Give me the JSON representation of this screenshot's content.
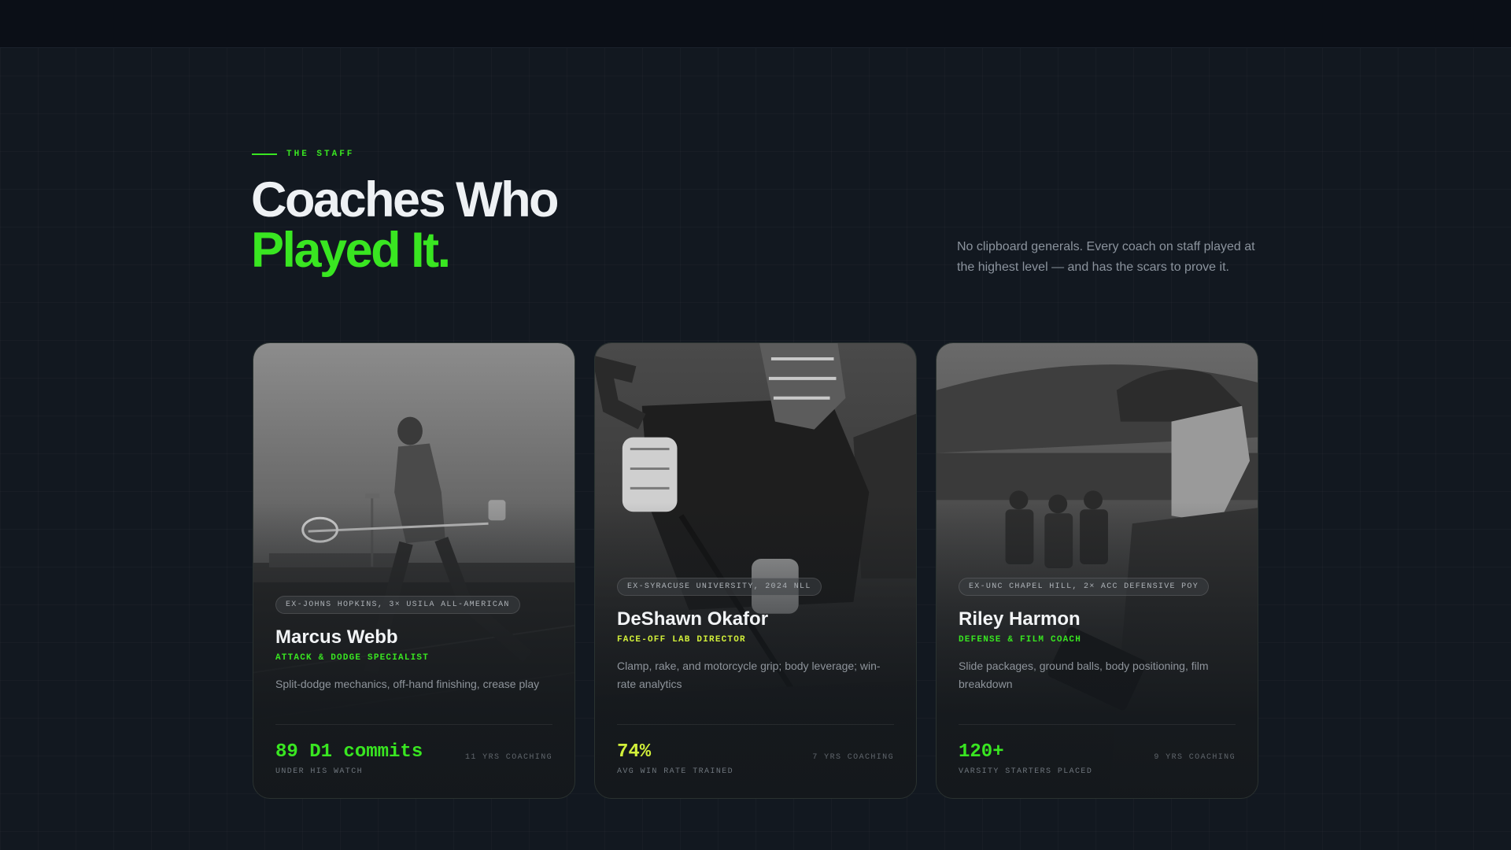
{
  "section": {
    "eyebrow": "THE STAFF",
    "title_line1": "Coaches Who",
    "title_line2": "Played It.",
    "intro": "No clipboard generals. Every coach on staff played at the highest level — and has the scars to prove it."
  },
  "colors": {
    "accent_green": "#39e621",
    "accent_lime": "#d2f03a",
    "background": "#121820"
  },
  "coaches": [
    {
      "badge": "EX-JOHNS HOPKINS, 3× USILA ALL-AMERICAN",
      "name": "Marcus Webb",
      "role": "ATTACK & DODGE SPECIALIST",
      "description": "Split-dodge mechanics, off-hand finishing, crease play",
      "stat_value": "89 D1 commits",
      "stat_label": "UNDER HIS WATCH",
      "years": "11 YRS COACHING",
      "accent": "#39e621",
      "photo": "lacrosse-player-running-photo"
    },
    {
      "badge": "EX-SYRACUSE UNIVERSITY, 2024 NLL",
      "name": "DeShawn Okafor",
      "role": "FACE-OFF LAB DIRECTOR",
      "description": "Clamp, rake, and motorcycle grip; body leverage; win-rate analytics",
      "stat_value": "74%",
      "stat_label": "AVG WIN RATE TRAINED",
      "years": "7 YRS COACHING",
      "accent": "#d2f03a",
      "photo": "faceoff-stance-photo"
    },
    {
      "badge": "EX-UNC CHAPEL HILL, 2× ACC DEFENSIVE POY",
      "name": "Riley Harmon",
      "role": "DEFENSE & FILM COACH",
      "description": "Slide packages, ground balls, body positioning, film breakdown",
      "stat_value": "120+",
      "stat_label": "VARSITY STARTERS PLACED",
      "years": "9 YRS COACHING",
      "accent": "#39e621",
      "photo": "coach-with-tablet-photo"
    }
  ]
}
